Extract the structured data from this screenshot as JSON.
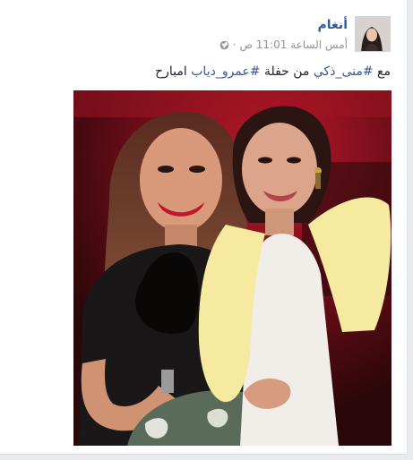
{
  "post": {
    "author": "أنغام",
    "time": "أمس الساعة 11:01 ص",
    "separator": "·",
    "text": {
      "prefix": "مع ",
      "hashtag1": "#منى_ذكي",
      "middle": " من حفلة ",
      "hashtag2": "#عمرو_دياب",
      "suffix": " امبارح"
    }
  },
  "icons": {
    "audience": "globe-icon"
  },
  "colors": {
    "link": "#365899",
    "meta": "#90949c",
    "text": "#1d2129",
    "background": "#e9ebee"
  }
}
